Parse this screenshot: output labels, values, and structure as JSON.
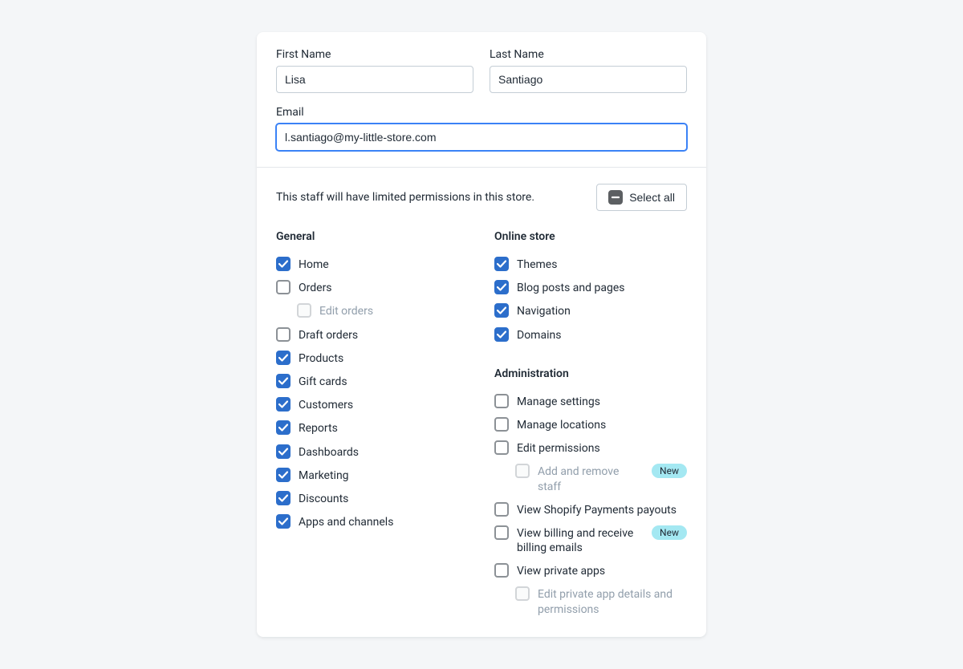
{
  "form": {
    "first_name_label": "First Name",
    "first_name_value": "Lisa",
    "last_name_label": "Last Name",
    "last_name_value": "Santiago",
    "email_label": "Email",
    "email_value": "l.santiago@my-little-store.com"
  },
  "permissions_intro": "This staff will have limited permissions in this store.",
  "select_all_label": "Select all",
  "select_all_state": "indeterminate",
  "badge_new_label": "New",
  "colors": {
    "accent": "#2c6ecb",
    "border": "#c4cdd5",
    "badge_bg": "#a4e8f2"
  },
  "groups": [
    {
      "key": "general",
      "column": 0,
      "heading": "General",
      "items": [
        {
          "label": "Home",
          "checked": true,
          "disabled": false,
          "indent": false,
          "badge": false
        },
        {
          "label": "Orders",
          "checked": false,
          "disabled": false,
          "indent": false,
          "badge": false
        },
        {
          "label": "Edit orders",
          "checked": false,
          "disabled": true,
          "indent": true,
          "badge": false
        },
        {
          "label": "Draft orders",
          "checked": false,
          "disabled": false,
          "indent": false,
          "badge": false
        },
        {
          "label": "Products",
          "checked": true,
          "disabled": false,
          "indent": false,
          "badge": false
        },
        {
          "label": "Gift cards",
          "checked": true,
          "disabled": false,
          "indent": false,
          "badge": false
        },
        {
          "label": "Customers",
          "checked": true,
          "disabled": false,
          "indent": false,
          "badge": false
        },
        {
          "label": "Reports",
          "checked": true,
          "disabled": false,
          "indent": false,
          "badge": false
        },
        {
          "label": "Dashboards",
          "checked": true,
          "disabled": false,
          "indent": false,
          "badge": false
        },
        {
          "label": "Marketing",
          "checked": true,
          "disabled": false,
          "indent": false,
          "badge": false
        },
        {
          "label": "Discounts",
          "checked": true,
          "disabled": false,
          "indent": false,
          "badge": false
        },
        {
          "label": "Apps and channels",
          "checked": true,
          "disabled": false,
          "indent": false,
          "badge": false
        }
      ]
    },
    {
      "key": "online_store",
      "column": 1,
      "heading": "Online store",
      "items": [
        {
          "label": "Themes",
          "checked": true,
          "disabled": false,
          "indent": false,
          "badge": false
        },
        {
          "label": "Blog posts and pages",
          "checked": true,
          "disabled": false,
          "indent": false,
          "badge": false
        },
        {
          "label": "Navigation",
          "checked": true,
          "disabled": false,
          "indent": false,
          "badge": false
        },
        {
          "label": "Domains",
          "checked": true,
          "disabled": false,
          "indent": false,
          "badge": false
        }
      ]
    },
    {
      "key": "administration",
      "column": 1,
      "heading": "Administration",
      "items": [
        {
          "label": "Manage settings",
          "checked": false,
          "disabled": false,
          "indent": false,
          "badge": false
        },
        {
          "label": "Manage locations",
          "checked": false,
          "disabled": false,
          "indent": false,
          "badge": false
        },
        {
          "label": "Edit permissions",
          "checked": false,
          "disabled": false,
          "indent": false,
          "badge": false
        },
        {
          "label": "Add and remove staff",
          "checked": false,
          "disabled": true,
          "indent": true,
          "badge": true
        },
        {
          "label": "View Shopify Payments payouts",
          "checked": false,
          "disabled": false,
          "indent": false,
          "badge": false
        },
        {
          "label": "View billing and receive billing emails",
          "checked": false,
          "disabled": false,
          "indent": false,
          "badge": true
        },
        {
          "label": "View private apps",
          "checked": false,
          "disabled": false,
          "indent": false,
          "badge": false
        },
        {
          "label": "Edit private app details and permissions",
          "checked": false,
          "disabled": true,
          "indent": true,
          "badge": false
        }
      ]
    }
  ]
}
